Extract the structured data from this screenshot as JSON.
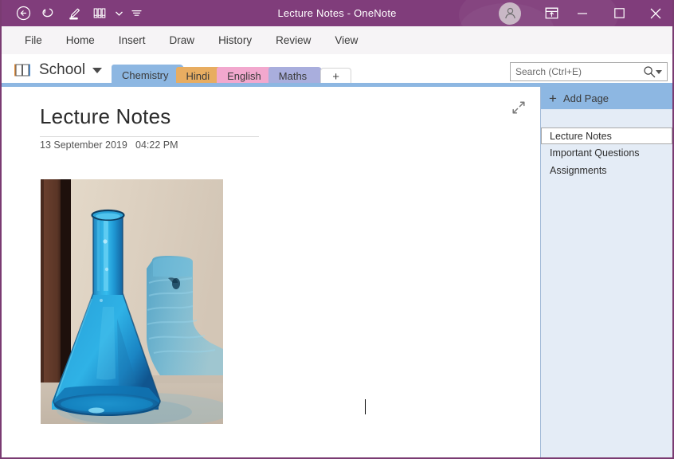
{
  "window": {
    "title": "Lecture Notes  -  OneNote",
    "accent_color": "#803D7B",
    "border_color": "#7A3B72",
    "quick_access": [
      {
        "name": "back-icon",
        "label": "Back"
      },
      {
        "name": "undo-icon",
        "label": "Undo"
      },
      {
        "name": "touch-pen-icon",
        "label": "Draw with Touch"
      },
      {
        "name": "pens-icon",
        "label": "Pens"
      },
      {
        "name": "customize-quick-access-icon",
        "label": "Customize Quick Access Toolbar"
      }
    ],
    "controls": {
      "account_icon": "user-avatar-icon",
      "ribbon_display_options": "ribbon-display-options-icon",
      "minimize": "minimize-icon",
      "maximize": "maximize-icon",
      "close": "close-icon"
    }
  },
  "menubar": {
    "items": [
      {
        "label": "File"
      },
      {
        "label": "Home"
      },
      {
        "label": "Insert"
      },
      {
        "label": "Draw"
      },
      {
        "label": "History"
      },
      {
        "label": "Review"
      },
      {
        "label": "View"
      }
    ]
  },
  "notebook": {
    "name": "School",
    "icon": "notebook-icon",
    "caret": "chevron-down-icon"
  },
  "sections": {
    "active_color": "#8DB7E2",
    "tabs": [
      {
        "label": "Chemistry",
        "color": "#8DB7E2",
        "active": true
      },
      {
        "label": "Hindi",
        "color": "#E8AD61",
        "active": false
      },
      {
        "label": "English",
        "color": "#F2A8CE",
        "active": false
      },
      {
        "label": "Maths",
        "color": "#A9AEDD",
        "active": false
      }
    ],
    "add_section_label": "+"
  },
  "search": {
    "placeholder": "Search (Ctrl+E)",
    "value": "",
    "icon": "search-icon",
    "caret": "chevron-down-icon"
  },
  "page": {
    "title": "Lecture Notes",
    "date": "13 September 2019",
    "time": "04:22 PM",
    "expand_icon": "expand-page-icon",
    "image": {
      "name": "conical-flask-photo",
      "alt": "Blue glass conical flask on a windowsill with its shadow"
    }
  },
  "page_pane": {
    "add_page_label": "Add Page",
    "add_page_icon": "plus-icon",
    "pages": [
      {
        "label": "Lecture Notes",
        "selected": true
      },
      {
        "label": "Important Questions",
        "selected": false
      },
      {
        "label": "Assignments",
        "selected": false
      }
    ]
  }
}
